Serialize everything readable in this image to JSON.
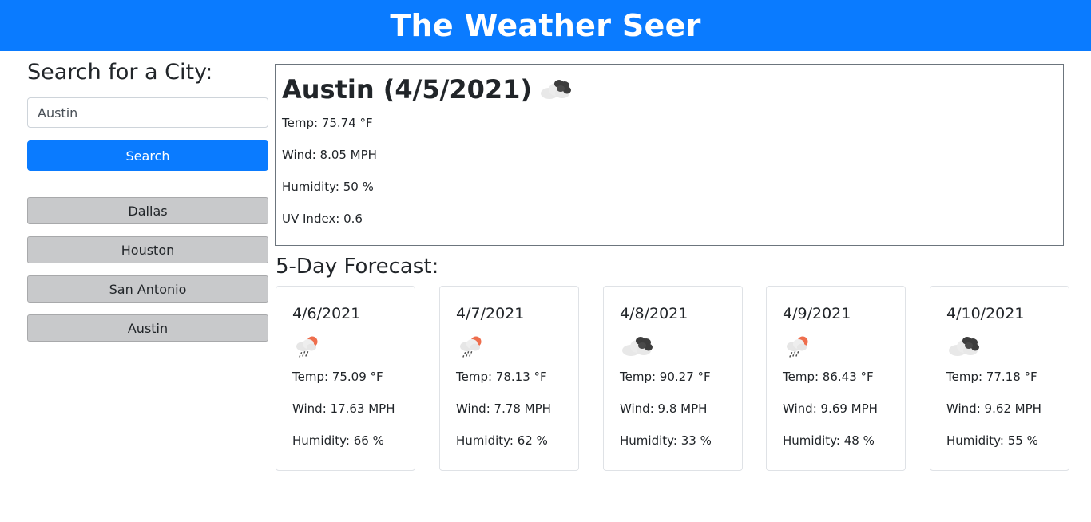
{
  "header": {
    "title": "The Weather Seer"
  },
  "search": {
    "heading": "Search for a City:",
    "input_value": "Austin",
    "button_label": "Search"
  },
  "history": [
    {
      "label": "Dallas"
    },
    {
      "label": "Houston"
    },
    {
      "label": "San Antonio"
    },
    {
      "label": "Austin"
    }
  ],
  "current": {
    "title": "Austin (4/5/2021)",
    "icon": "cloudy-icon",
    "temp": "Temp: 75.74 °F",
    "wind": "Wind: 8.05 MPH",
    "humidity": "Humidity: 50 %",
    "uv": "UV Index: 0.6"
  },
  "forecast": {
    "heading": "5-Day Forecast:",
    "days": [
      {
        "date": "4/6/2021",
        "icon": "rain-sun-icon",
        "temp": "Temp: 75.09 °F",
        "wind": "Wind: 17.63 MPH",
        "humidity": "Humidity: 66 %"
      },
      {
        "date": "4/7/2021",
        "icon": "rain-sun-icon",
        "temp": "Temp: 78.13 °F",
        "wind": "Wind: 7.78 MPH",
        "humidity": "Humidity: 62 %"
      },
      {
        "date": "4/8/2021",
        "icon": "cloudy-icon",
        "temp": "Temp: 90.27 °F",
        "wind": "Wind: 9.8 MPH",
        "humidity": "Humidity: 33 %"
      },
      {
        "date": "4/9/2021",
        "icon": "rain-sun-icon",
        "temp": "Temp: 86.43 °F",
        "wind": "Wind: 9.69 MPH",
        "humidity": "Humidity: 48 %"
      },
      {
        "date": "4/10/2021",
        "icon": "cloudy-icon",
        "temp": "Temp: 77.18 °F",
        "wind": "Wind: 9.62 MPH",
        "humidity": "Humidity: 55 %"
      }
    ]
  },
  "colors": {
    "brand": "#0a7bff",
    "history_bg": "#c8c9cb",
    "sun": "#ee6e4d",
    "cloud_dark": "#3d3d3d",
    "cloud_light": "#e8e8e8"
  }
}
